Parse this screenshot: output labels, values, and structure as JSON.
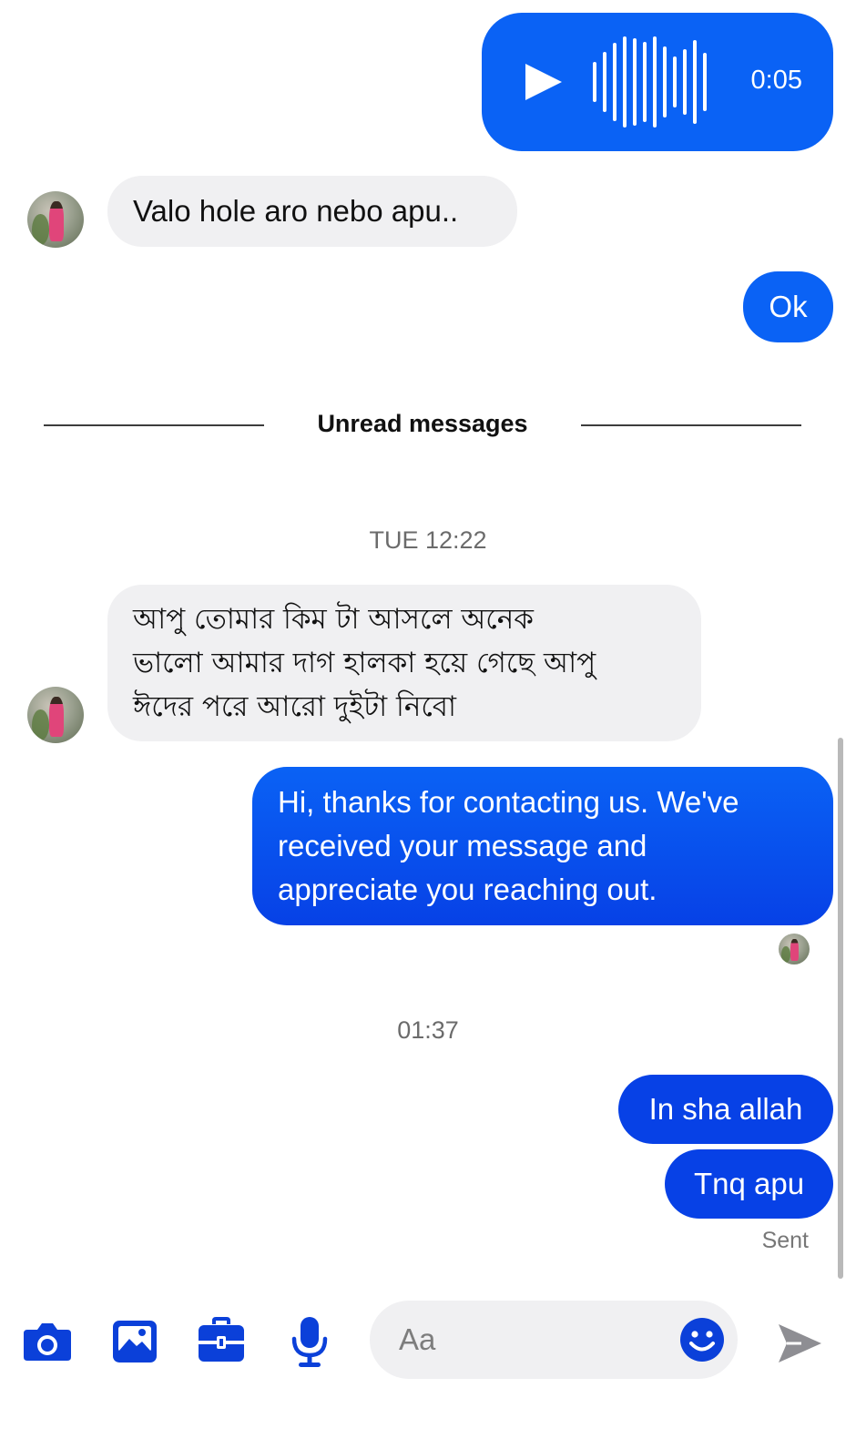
{
  "voice_message": {
    "duration": "0:05"
  },
  "messages": {
    "m1": "Valo hole aro nebo apu..",
    "m2": "Ok",
    "m3_line1": "আপু তোমার কিম টা আসলে অনেক",
    "m3_line2": "ভালো আমার দাগ হালকা হয়ে গেছে আপু",
    "m3_line3": "ঈদের পরে আরো দুইটা নিবো",
    "m4_line1": "Hi, thanks for contacting us. We've",
    "m4_line2": "received your message and",
    "m4_line3": "appreciate you reaching out.",
    "m5": "In sha allah",
    "m6": "Tnq apu"
  },
  "divider": {
    "label": "Unread messages"
  },
  "timestamps": {
    "t1": "TUE 12:22",
    "t2": "01:37"
  },
  "status": {
    "sent": "Sent"
  },
  "composer": {
    "placeholder": "Aa"
  },
  "icons": {
    "camera": "camera-icon",
    "gallery": "image-icon",
    "toolbox": "briefcase-icon",
    "mic": "microphone-icon",
    "emoji": "smiley-icon",
    "send": "send-icon"
  },
  "colors": {
    "accent": "#0a62f5",
    "accent_dark": "#0741e6",
    "incoming_bg": "#f0f0f2",
    "icon_blue": "#0b40d9",
    "send_disabled": "#8e8e93"
  }
}
